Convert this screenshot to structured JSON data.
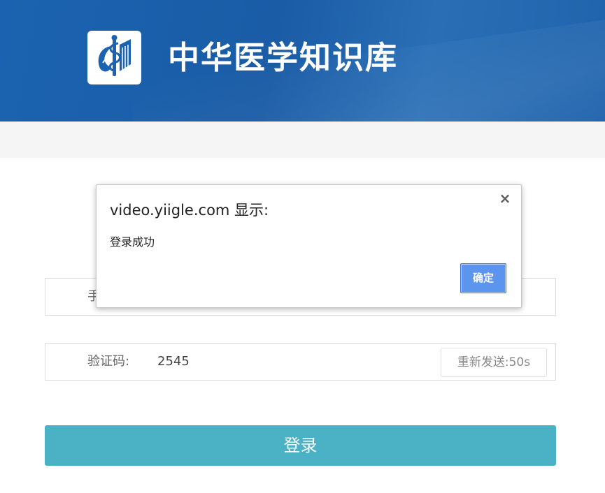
{
  "header": {
    "site_title": "中华医学知识库",
    "brand_color": "#1b63b0",
    "logo_icon": "caduceus-book-icon"
  },
  "form": {
    "phone_label_visible": "手",
    "code_label": "验证码:",
    "code_value": "2545",
    "resend_label": "重新发送:50s",
    "login_label": "登录",
    "login_color": "#4bb2c6"
  },
  "dialog": {
    "title": "video.yiigle.com 显示:",
    "message": "登录成功",
    "close_symbol": "×",
    "ok_label": "确定",
    "ok_color": "#5b95ee"
  }
}
